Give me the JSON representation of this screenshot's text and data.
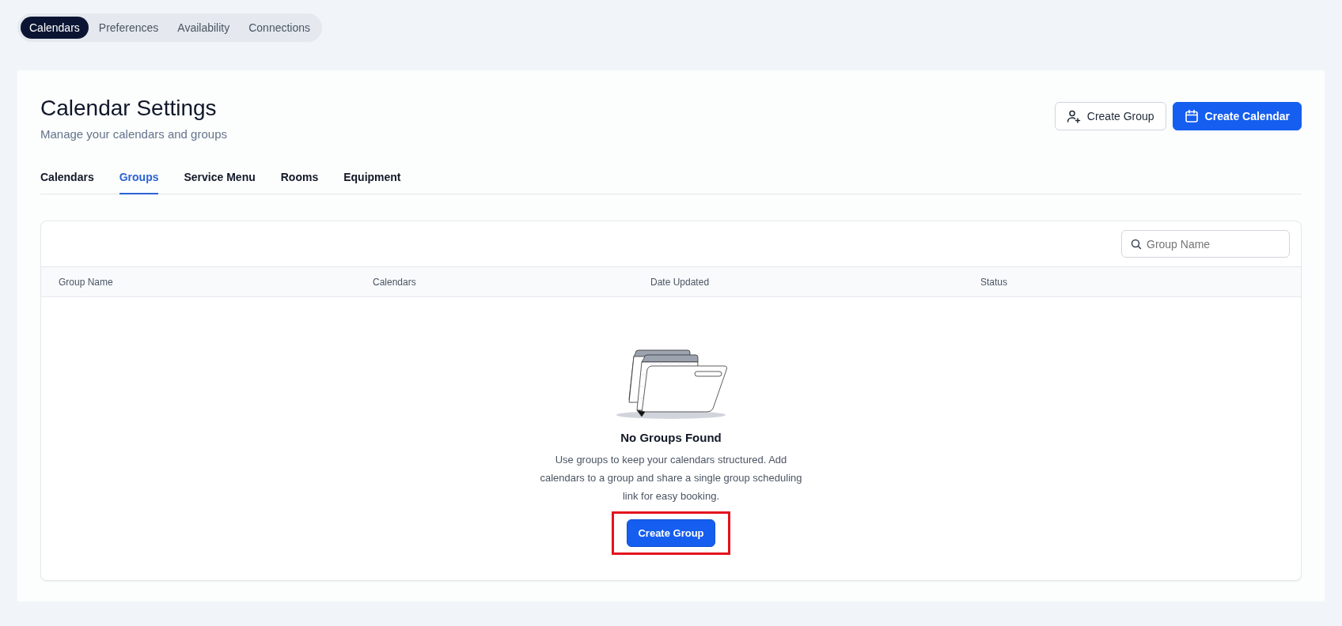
{
  "top_tabs": [
    {
      "label": "Calendars",
      "selected": true
    },
    {
      "label": "Preferences",
      "selected": false
    },
    {
      "label": "Availability",
      "selected": false
    },
    {
      "label": "Connections",
      "selected": false
    }
  ],
  "header": {
    "title": "Calendar Settings",
    "subtitle": "Manage your calendars and groups",
    "buttons": [
      {
        "label": "Create Group",
        "kind": "secondary"
      },
      {
        "label": "Create Calendar",
        "kind": "primary"
      }
    ]
  },
  "tabs": [
    {
      "label": "Calendars",
      "selected": false
    },
    {
      "label": "Groups",
      "selected": true
    },
    {
      "label": "Service Menu",
      "selected": false
    },
    {
      "label": "Rooms",
      "selected": false
    },
    {
      "label": "Equipment",
      "selected": false
    }
  ],
  "search": {
    "placeholder": "Group Name"
  },
  "table": {
    "columns": [
      "Group Name",
      "Calendars",
      "Date Updated",
      "Status"
    ]
  },
  "empty_state": {
    "title": "No Groups Found",
    "message": "Use groups to keep your calendars structured. Add calendars to a group and share a single group scheduling link for easy booking.",
    "button": {
      "label": "Create Group",
      "highlighted": true
    }
  }
}
